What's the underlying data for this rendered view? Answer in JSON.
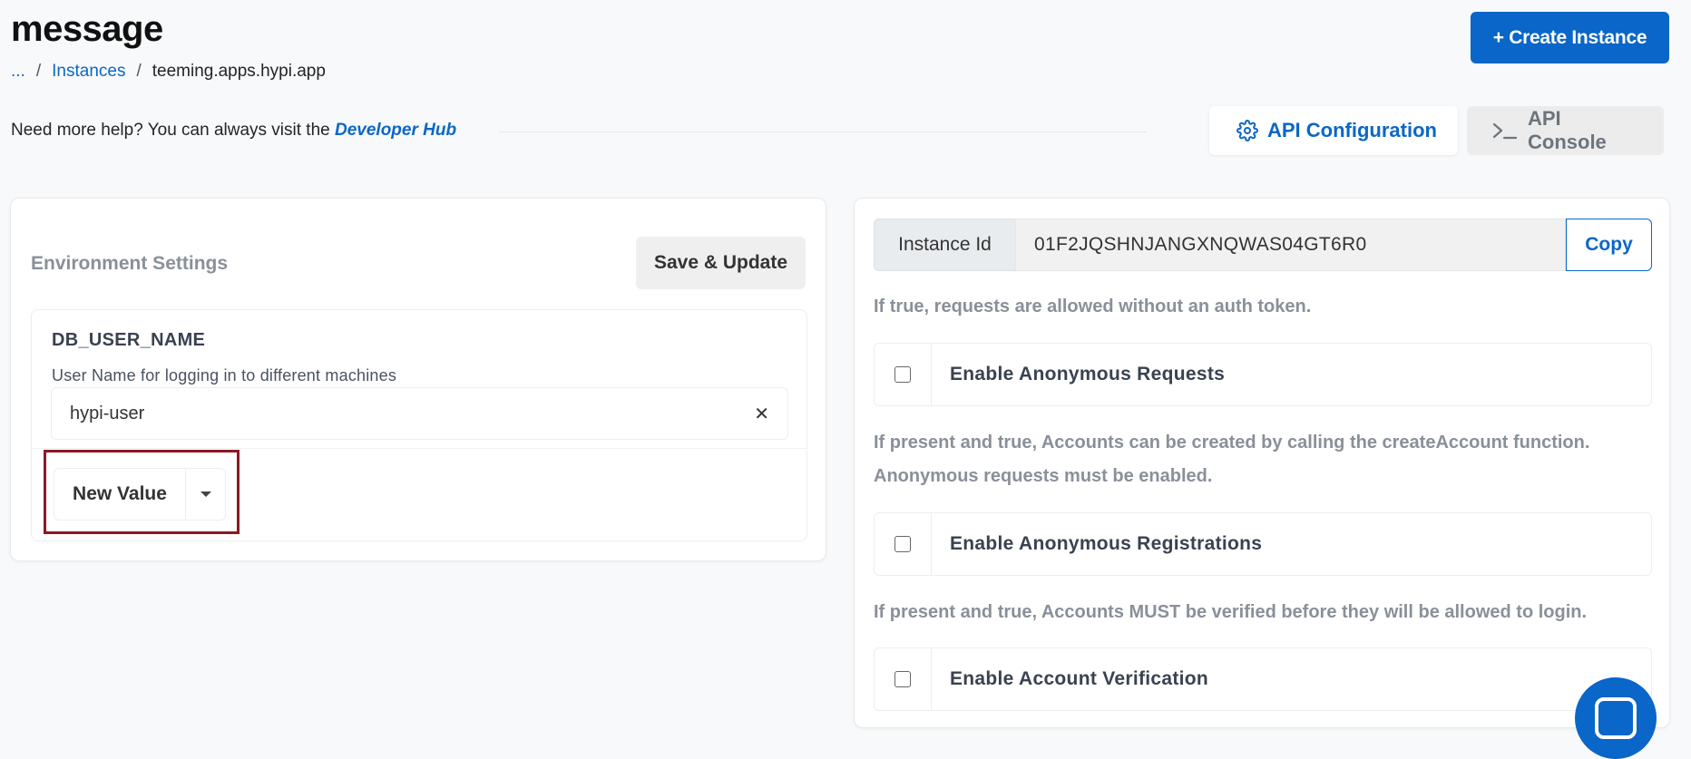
{
  "page": {
    "title": "message"
  },
  "breadcrumb": {
    "ellipsis": "...",
    "instances": "Instances",
    "current": "teeming.apps.hypi.app",
    "separator": "/"
  },
  "header": {
    "create_button": "+ Create Instance"
  },
  "help": {
    "text": "Need more help? You can always visit the ",
    "link": "Developer Hub"
  },
  "api_tabs": {
    "config": {
      "label": "API Configuration",
      "icon": "gear-icon"
    },
    "console": {
      "label": "API Console",
      "icon": "terminal-icon"
    }
  },
  "env_settings": {
    "title": "Environment Settings",
    "save_button": "Save & Update",
    "variable": {
      "name": "DB_USER_NAME",
      "description": "User Name for logging in to different machines",
      "value": "hypi-user"
    },
    "new_value_button": "New Value"
  },
  "instance": {
    "label": "Instance Id",
    "value": "01F2JQSHNJANGXNQWAS04GT6R0",
    "copy_button": "Copy"
  },
  "options": [
    {
      "description": "If true, requests are allowed without an auth token.",
      "label": "Enable Anonymous Requests",
      "checked": false
    },
    {
      "description": "If present and true, Accounts can be created by calling the createAccount function. Anonymous requests must be enabled.",
      "label": "Enable Anonymous Registrations",
      "checked": false
    },
    {
      "description": "If present and true, Accounts MUST be verified before they will be allowed to login.",
      "label": "Enable Account Verification",
      "checked": false
    }
  ],
  "colors": {
    "primary": "#0a66c8",
    "link": "#0b67c6",
    "highlight": "#8b1a24"
  }
}
